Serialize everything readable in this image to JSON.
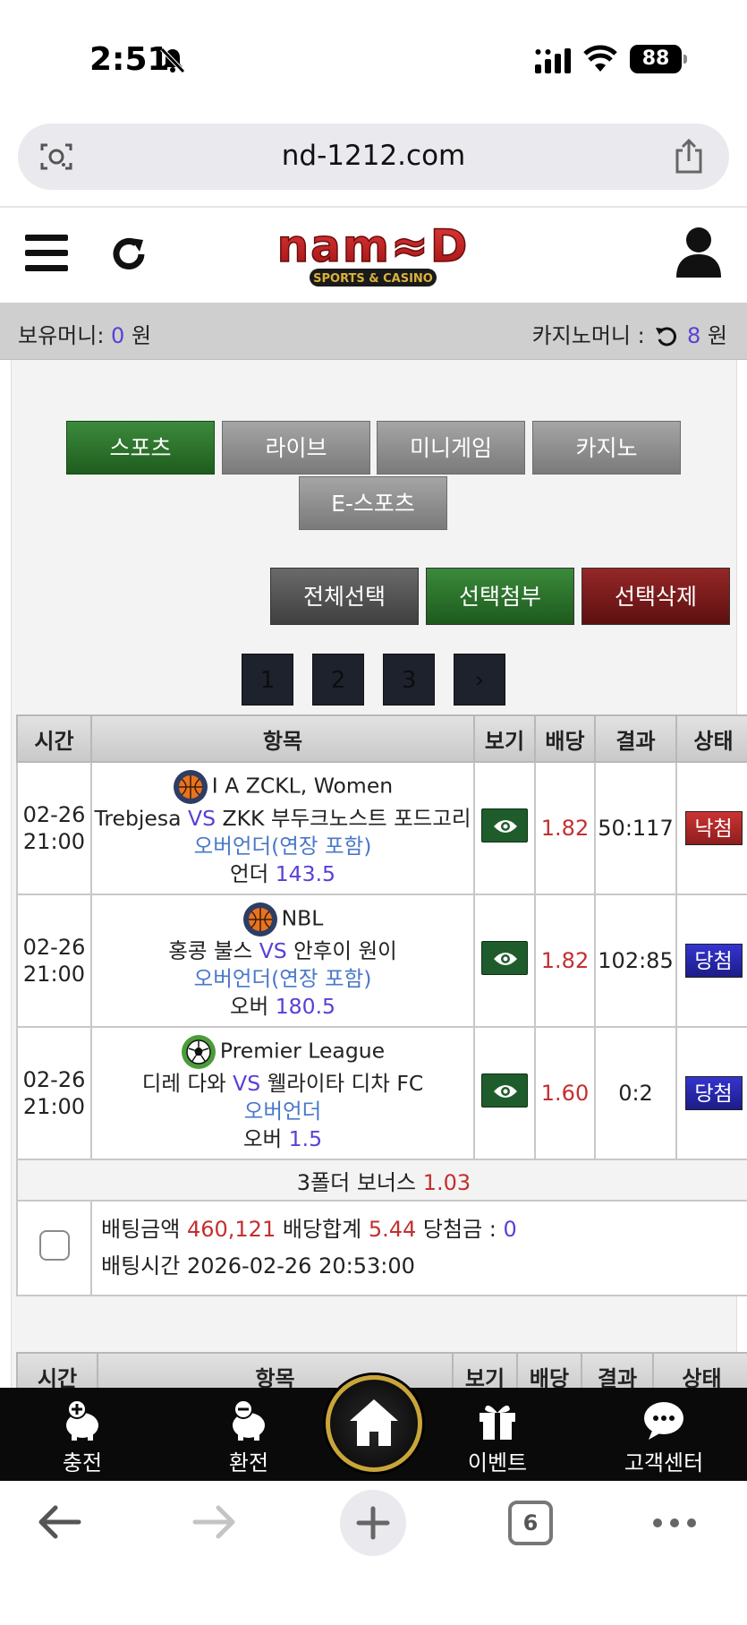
{
  "status_bar": {
    "time": "2:51",
    "battery": "88"
  },
  "browser": {
    "url": "nd-1212.com",
    "tab_count": "6"
  },
  "site": {
    "logo_text": "namd",
    "logo_subtitle": "SPORTS & CASINO",
    "money_label": "보유머니:",
    "money_value": "0",
    "money_unit": "원",
    "casino_label": "카지노머니 :",
    "casino_value": "8",
    "casino_unit": "원"
  },
  "tabs": [
    {
      "label": "스포츠",
      "active": true
    },
    {
      "label": "라이브",
      "active": false
    },
    {
      "label": "미니게임",
      "active": false
    },
    {
      "label": "카지노",
      "active": false
    },
    {
      "label": "E-스포츠",
      "active": false
    }
  ],
  "actions": {
    "select_all": "전체선택",
    "attach": "선택첨부",
    "delete": "선택삭제"
  },
  "pagination": {
    "pages": [
      "1",
      "2",
      "3"
    ],
    "next": "›"
  },
  "table": {
    "headers": [
      "시간",
      "항목",
      "보기",
      "배당",
      "결과",
      "상태"
    ],
    "rows": [
      {
        "date": "02-26",
        "time": "21:00",
        "league": "I A ZCKL, Women",
        "sport": "basketball",
        "home": "Trebjesa",
        "vs": "VS",
        "away": "ZKK 부두크노스트 포드고리",
        "market": "오버언더(연장 포함)",
        "pick": "언더",
        "line": "143.5",
        "odds": "1.82",
        "result": "50:117",
        "status": "낙첨"
      },
      {
        "date": "02-26",
        "time": "21:00",
        "league": "NBL",
        "sport": "basketball",
        "home": "홍콩 불스",
        "vs": "VS",
        "away": "안후이 원이",
        "market": "오버언더(연장 포함)",
        "pick": "오버",
        "line": "180.5",
        "odds": "1.82",
        "result": "102:85",
        "status": "당첨"
      },
      {
        "date": "02-26",
        "time": "21:00",
        "league": "Premier League",
        "sport": "soccer",
        "home": "디레 다와",
        "vs": "VS",
        "away": "웰라이타 디차 FC",
        "market": "오버언더",
        "pick": "오버",
        "line": "1.5",
        "odds": "1.60",
        "result": "0:2",
        "status": "당첨"
      }
    ],
    "bonus_label": "3폴더 보너스",
    "bonus_value": "1.03",
    "summary": {
      "bet_amount_label": "배팅금액",
      "bet_amount": "460,121",
      "odds_total_label": "배당합계",
      "odds_total": "5.44",
      "payout_label": "당첨금 :",
      "payout": "0",
      "bet_time_label": "배팅시간",
      "bet_time": "2026-02-26 20:53:00"
    }
  },
  "bottom_nav": {
    "deposit": "충전",
    "withdraw": "환전",
    "event": "이벤트",
    "support": "고객센터"
  },
  "colors": {
    "accent_purple": "#5a3fd6",
    "odds_red": "#c42f2f",
    "market_blue": "#4a78c8",
    "win_badge": "#2a2ab8",
    "lose_badge": "#b22a2a",
    "active_tab": "#2e7a2e"
  }
}
